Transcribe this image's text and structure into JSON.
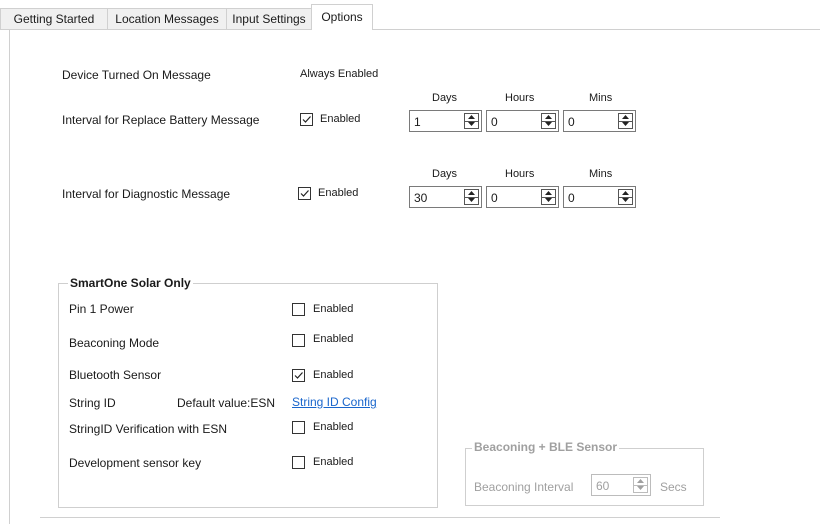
{
  "tabs": [
    {
      "label": "Getting Started"
    },
    {
      "label": "Location Messages"
    },
    {
      "label": "Input Settings"
    },
    {
      "label": "Options"
    }
  ],
  "device_on": {
    "label": "Device Turned On Message",
    "value": "Always Enabled"
  },
  "battery": {
    "label": "Interval for Replace Battery Message",
    "enabled_label": "Enabled",
    "enabled": true,
    "days_header": "Days",
    "hours_header": "Hours",
    "mins_header": "Mins",
    "days": "1",
    "hours": "0",
    "mins": "0"
  },
  "diagnostic": {
    "label": "Interval for Diagnostic Message",
    "enabled_label": "Enabled",
    "enabled": true,
    "days_header": "Days",
    "hours_header": "Hours",
    "mins_header": "Mins",
    "days": "30",
    "hours": "0",
    "mins": "0"
  },
  "solar": {
    "title": "SmartOne Solar Only",
    "pin1": {
      "label": "Pin 1 Power",
      "enabled_label": "Enabled",
      "enabled": false
    },
    "beaconing": {
      "label": "Beaconing Mode",
      "enabled_label": "Enabled",
      "enabled": false
    },
    "bluetooth": {
      "label": "Bluetooth Sensor",
      "enabled_label": "Enabled",
      "enabled": true
    },
    "string_id": {
      "label": "String ID",
      "default": "Default value:ESN",
      "link": "String ID Config"
    },
    "verification": {
      "label": "StringID Verification with ESN",
      "enabled_label": "Enabled",
      "enabled": false
    },
    "dev_key": {
      "label": "Development sensor key",
      "enabled_label": "Enabled",
      "enabled": false
    }
  },
  "ble": {
    "title": "Beaconing + BLE Sensor",
    "interval_label": "Beaconing Interval",
    "interval_value": "60",
    "unit": "Secs"
  }
}
